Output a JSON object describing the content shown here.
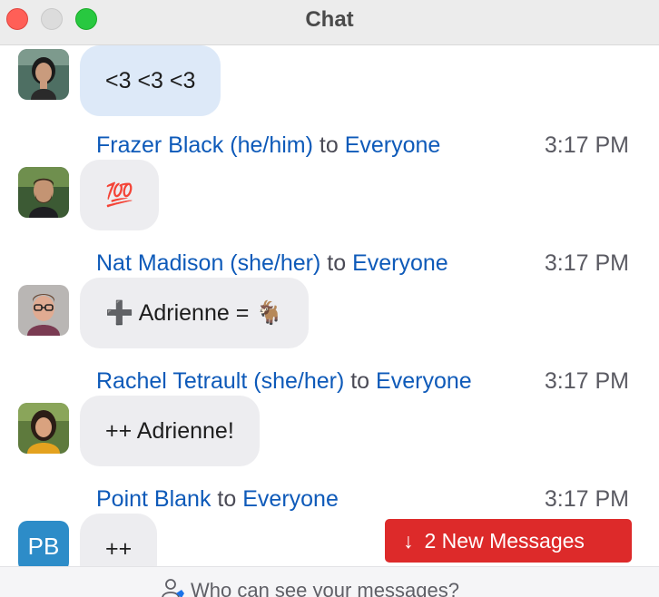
{
  "window": {
    "title": "Chat"
  },
  "chat": {
    "first_message": {
      "text": "<3 <3 <3"
    },
    "messages": [
      {
        "sender": "Frazer Black (he/him)",
        "to_word": "to",
        "recipient": "Everyone",
        "time": "3:17 PM",
        "text": "💯"
      },
      {
        "sender": "Nat Madison (she/her)",
        "to_word": "to",
        "recipient": "Everyone",
        "time": "3:17 PM",
        "text": "➕ Adrienne = 🐐"
      },
      {
        "sender": "Rachel Tetrault (she/her)",
        "to_word": "to",
        "recipient": "Everyone",
        "time": "3:17 PM",
        "text": "++ Adrienne!"
      },
      {
        "sender": "Point Blank",
        "to_word": "to",
        "recipient": "Everyone",
        "time": "3:17 PM",
        "text": "++",
        "avatar_initials": "PB"
      }
    ]
  },
  "new_messages": {
    "arrow": "↓",
    "label": "2 New Messages",
    "color": "#dd2a2a"
  },
  "footer": {
    "who_can_see": "Who can see your messages?",
    "icon": "person-icon"
  },
  "colors": {
    "name_link": "#0e5ab9",
    "bubble": "#ededf0",
    "own_bubble": "#dde9f8",
    "avatar_initials_bg": "#2d8cc8"
  }
}
